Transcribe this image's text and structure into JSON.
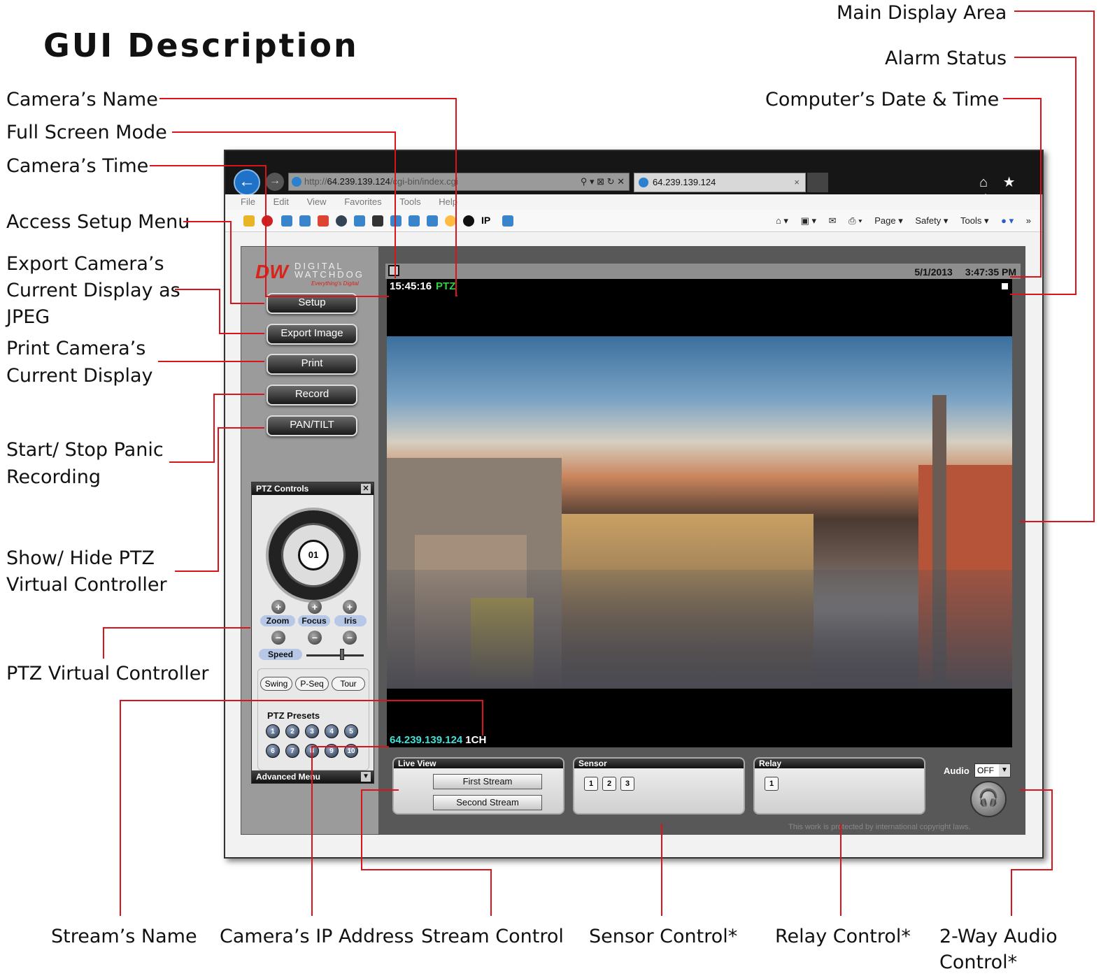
{
  "title": "GUI Description",
  "callouts": {
    "left": [
      {
        "id": "cam-name",
        "lines": [
          "Camera’s Name"
        ]
      },
      {
        "id": "full-screen",
        "lines": [
          "Full Screen Mode"
        ]
      },
      {
        "id": "cam-time",
        "lines": [
          "Camera’s Time"
        ]
      },
      {
        "id": "setup",
        "lines": [
          "Access Setup Menu"
        ]
      },
      {
        "id": "export",
        "lines": [
          "Export Camera’s",
          "Current Display as",
          "JPEG"
        ]
      },
      {
        "id": "print",
        "lines": [
          "Print Camera’s",
          "Current Display"
        ]
      },
      {
        "id": "panic",
        "lines": [
          "Start/ Stop Panic",
          "Recording"
        ]
      },
      {
        "id": "showhide",
        "lines": [
          "Show/ Hide PTZ",
          "Virtual Controller"
        ]
      },
      {
        "id": "ptzvc",
        "lines": [
          "PTZ Virtual Controller"
        ]
      }
    ],
    "right": [
      {
        "id": "main-display",
        "lines": [
          "Main Display Area"
        ]
      },
      {
        "id": "alarm",
        "lines": [
          "Alarm Status"
        ]
      },
      {
        "id": "datetime",
        "lines": [
          "Computer’s Date & Time"
        ]
      }
    ],
    "bottom": [
      {
        "id": "stream-name",
        "lines": [
          "Stream’s Name"
        ]
      },
      {
        "id": "ip",
        "lines": [
          "Camera’s IP Address"
        ]
      },
      {
        "id": "stream-ctl",
        "lines": [
          "Stream Control"
        ]
      },
      {
        "id": "sensor",
        "lines": [
          "Sensor Control*"
        ]
      },
      {
        "id": "relay",
        "lines": [
          "Relay Control*"
        ]
      },
      {
        "id": "audio",
        "lines": [
          "2-Way Audio",
          "Control*"
        ]
      }
    ]
  },
  "browser": {
    "url_prefix": "http://",
    "url_host": "64.239.139.124",
    "url_path": "/cgi-bin/index.cgi",
    "address_controls": "⚲ ▾ ⊠ ↻ ✕",
    "tab_title": "64.239.139.124",
    "tab_close": "×",
    "window_icons": "⌂ ★ ⚙",
    "menu": [
      "File",
      "Edit",
      "View",
      "Favorites",
      "Tools",
      "Help"
    ],
    "fav_ip_label": "IP",
    "commands": [
      "Page ▾",
      "Safety ▾",
      "Tools ▾"
    ],
    "chevron": "»"
  },
  "app": {
    "logo_mark": "DW",
    "logo_text": "DIGITAL WATCHDOG",
    "logo_tagline": "Everything's Digital",
    "buttons": {
      "setup": "Setup",
      "export": "Export Image",
      "print": "Print",
      "record": "Record",
      "pantilt": "PAN/TILT"
    },
    "ptz": {
      "title": "PTZ Controls",
      "close": "✕",
      "dial_center": "01",
      "zoom": "Zoom",
      "focus": "Focus",
      "iris": "Iris",
      "speed": "Speed",
      "plus": "+",
      "minus": "−",
      "modes": [
        "Swing",
        "P-Seq",
        "Tour"
      ],
      "presets_title": "PTZ Presets",
      "presets": [
        "1",
        "2",
        "3",
        "4",
        "5",
        "6",
        "7",
        "8",
        "9",
        "10"
      ],
      "advanced": "Advanced Menu",
      "advanced_icon": "▼"
    },
    "date": "5/1/2013",
    "time": "3:47:35 PM",
    "camera_time": "15:45:16",
    "camera_name": "PTZ",
    "camera_ip": "64.239.139.124",
    "stream_name": "1CH",
    "live_view": {
      "title": "Live View",
      "first": "First Stream",
      "second": "Second Stream"
    },
    "sensor": {
      "title": "Sensor",
      "items": [
        "1",
        "2",
        "3"
      ]
    },
    "relay": {
      "title": "Relay",
      "items": [
        "1"
      ]
    },
    "audio": {
      "label": "Audio",
      "value": "OFF",
      "dropdown": "▼",
      "icon": "🎧"
    },
    "copyright": "This work is protected by international copyright laws."
  },
  "colors": {
    "callout_line": "#d9141b",
    "ptz_green": "#2fd04a",
    "ip_cyan": "#3fe0d8",
    "logo_red": "#d8241b"
  }
}
